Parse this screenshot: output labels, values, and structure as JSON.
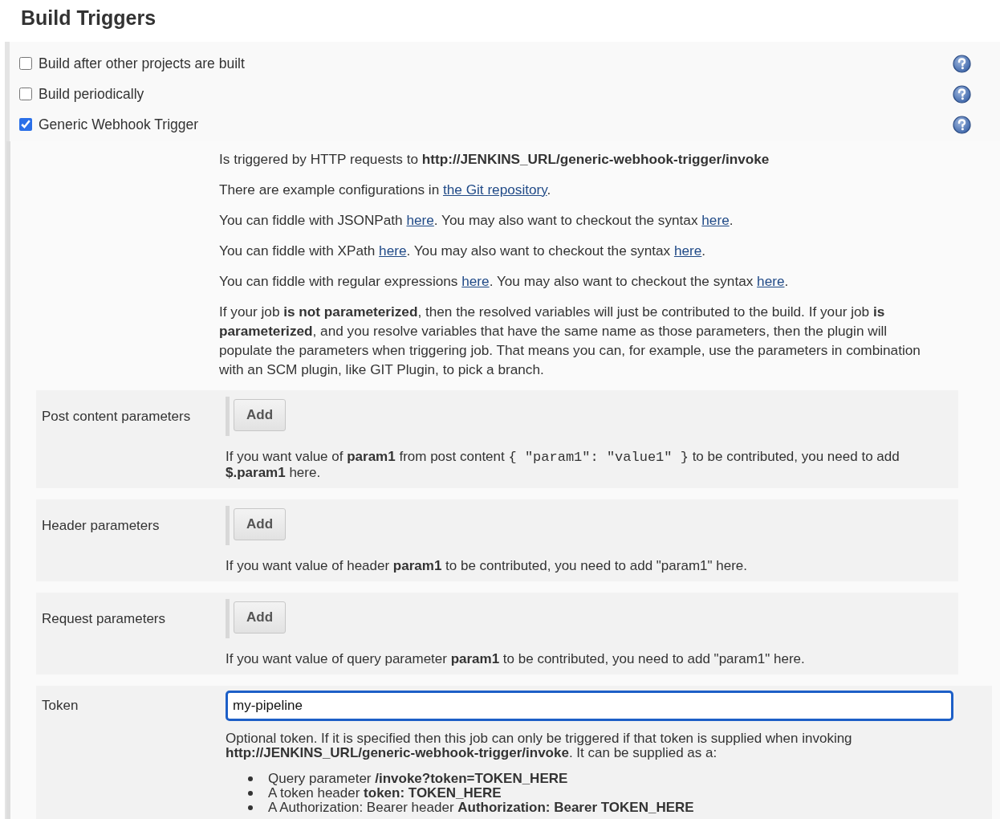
{
  "section_title": "Build Triggers",
  "triggers": [
    {
      "label": "Build after other projects are built",
      "checked": false
    },
    {
      "label": "Build periodically",
      "checked": false
    },
    {
      "label": "Generic Webhook Trigger",
      "checked": true
    }
  ],
  "description": [
    [
      {
        "kind": "text",
        "text": "Is triggered by HTTP requests to **http://JENKINS_URL/generic-webhook-trigger/invoke**"
      }
    ],
    [
      {
        "kind": "text",
        "text": "There are example configurations in "
      },
      {
        "kind": "link",
        "text": "the Git repository"
      },
      {
        "kind": "text",
        "text": "."
      }
    ],
    [
      {
        "kind": "text",
        "text": "You can fiddle with JSONPath "
      },
      {
        "kind": "link",
        "text": "here"
      },
      {
        "kind": "text",
        "text": ". You may also want to checkout the syntax "
      },
      {
        "kind": "link",
        "text": "here"
      },
      {
        "kind": "text",
        "text": "."
      }
    ],
    [
      {
        "kind": "text",
        "text": "You can fiddle with XPath "
      },
      {
        "kind": "link",
        "text": "here"
      },
      {
        "kind": "text",
        "text": ". You may also want to checkout the syntax "
      },
      {
        "kind": "link",
        "text": "here"
      },
      {
        "kind": "text",
        "text": "."
      }
    ],
    [
      {
        "kind": "text",
        "text": "You can fiddle with regular expressions "
      },
      {
        "kind": "link",
        "text": "here"
      },
      {
        "kind": "text",
        "text": ". You may also want to checkout the syntax "
      },
      {
        "kind": "link",
        "text": "here"
      },
      {
        "kind": "text",
        "text": "."
      }
    ],
    [
      {
        "kind": "text",
        "text": "If your job **is not parameterized**, then the resolved variables will just be contributed to the build. If your job **is parameterized**, and you resolve variables that have the same name as those parameters, then the plugin will populate the parameters when triggering job. That means you can, for example, use the parameters in combination with an SCM plugin, like GIT Plugin, to pick a branch."
      }
    ]
  ],
  "parameter_sections": [
    {
      "label": "Post content parameters",
      "button": "Add",
      "help": [
        {
          "kind": "text",
          "text": "If you want value of **param1** from post content "
        },
        {
          "kind": "code",
          "text": "{ \"param1\": \"value1\" }"
        },
        {
          "kind": "text",
          "text": " to be contributed, you need to add **$.param1** here."
        }
      ]
    },
    {
      "label": "Header parameters",
      "button": "Add",
      "help": [
        {
          "kind": "text",
          "text": "If you want value of header **param1** to be contributed, you need to add \"param1\" here."
        }
      ]
    },
    {
      "label": "Request parameters",
      "button": "Add",
      "help": [
        {
          "kind": "text",
          "text": "If you want value of query parameter **param1** to be contributed, you need to add \"param1\" here."
        }
      ]
    }
  ],
  "token": {
    "label": "Token",
    "value": "my-pipeline",
    "focused": true,
    "help": [
      {
        "kind": "text",
        "text": "Optional token. If it is specified then this job can only be triggered if that token is supplied when invoking **http://JENKINS_URL/generic-webhook-trigger/invoke**. It can be supplied as a:"
      }
    ],
    "options": [
      "Query parameter **/invoke?token=TOKEN_HERE**",
      "A token header **token: TOKEN_HERE**",
      "A Authorization: Bearer header **Authorization: Bearer TOKEN_HERE**"
    ]
  }
}
